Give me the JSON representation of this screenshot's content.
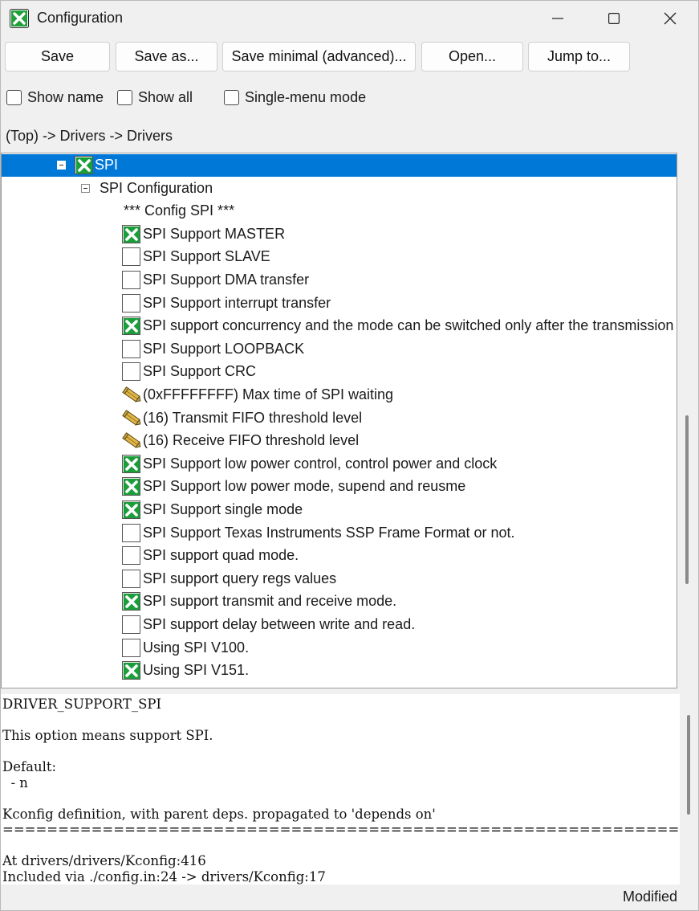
{
  "window": {
    "title": "Configuration",
    "icon": "x-checkbox-icon"
  },
  "toolbar": {
    "save": "Save",
    "save_as": "Save as...",
    "save_minimal": "Save minimal (advanced)...",
    "open": "Open...",
    "jump_to": "Jump to..."
  },
  "options": {
    "show_name": "Show name",
    "show_all": "Show all",
    "single_menu": "Single-menu mode",
    "show_name_checked": false,
    "show_all_checked": false,
    "single_menu_checked": false
  },
  "breadcrumb": "(Top) -> Drivers -> Drivers",
  "tree": {
    "rows": [
      {
        "kind": "menu-bool",
        "label": "SPI",
        "checked": true,
        "selected": true,
        "expander": true
      },
      {
        "kind": "menu",
        "label": "SPI Configuration",
        "expander": true
      },
      {
        "kind": "comment",
        "label": "*** Config SPI ***"
      },
      {
        "kind": "bool",
        "label": "SPI Support MASTER",
        "checked": true
      },
      {
        "kind": "bool",
        "label": "SPI Support SLAVE",
        "checked": false
      },
      {
        "kind": "bool",
        "label": "SPI Support DMA transfer",
        "checked": false
      },
      {
        "kind": "bool",
        "label": "SPI Support interrupt transfer",
        "checked": false
      },
      {
        "kind": "bool",
        "label": "SPI support concurrency and the mode can be switched only after the transmission",
        "checked": true
      },
      {
        "kind": "bool",
        "label": "SPI Support LOOPBACK",
        "checked": false
      },
      {
        "kind": "bool",
        "label": "SPI Support CRC",
        "checked": false
      },
      {
        "kind": "value",
        "label": "(0xFFFFFFFF) Max time of SPI waiting"
      },
      {
        "kind": "value",
        "label": "(16) Transmit FIFO threshold level"
      },
      {
        "kind": "value",
        "label": "(16) Receive FIFO threshold level"
      },
      {
        "kind": "bool",
        "label": "SPI Support low power control, control power and clock",
        "checked": true
      },
      {
        "kind": "bool",
        "label": "SPI Support low power mode, supend and reusme",
        "checked": true
      },
      {
        "kind": "bool",
        "label": "SPI Support single mode",
        "checked": true
      },
      {
        "kind": "bool",
        "label": "SPI Support Texas Instruments SSP Frame Format or not.",
        "checked": false
      },
      {
        "kind": "bool",
        "label": "SPI support quad mode.",
        "checked": false
      },
      {
        "kind": "bool",
        "label": "SPI support query regs values",
        "checked": false
      },
      {
        "kind": "bool",
        "label": "SPI support transmit and receive mode.",
        "checked": true
      },
      {
        "kind": "bool",
        "label": "SPI support delay between write and read.",
        "checked": false
      },
      {
        "kind": "bool",
        "label": "Using SPI V100.",
        "checked": false
      },
      {
        "kind": "bool",
        "label": "Using SPI V151.",
        "checked": true
      }
    ]
  },
  "help": {
    "text": "DRIVER_SUPPORT_SPI\n\nThis option means support SPI.\n\nDefault:\n  - n\n\nKconfig definition, with parent deps. propagated to 'depends on'\n=================================================================\n\nAt drivers/drivers/Kconfig:416\nIncluded via ./config.in:24 -> drivers/Kconfig:17"
  },
  "status": "Modified",
  "colors": {
    "selection": "#0078d7",
    "check_green": "#1a9e3a"
  }
}
